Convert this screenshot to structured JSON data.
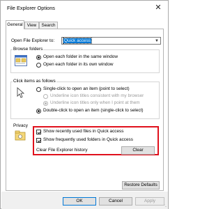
{
  "window": {
    "title": "File Explorer Options",
    "close_glyph": "✕"
  },
  "tabs": [
    {
      "label": "General"
    },
    {
      "label": "View"
    },
    {
      "label": "Search"
    }
  ],
  "general": {
    "open_label": "Open File Explorer to:",
    "open_value": "Quick access",
    "browse": {
      "title": "Browse folders",
      "opt_same": "Open each folder in the same window",
      "opt_own": "Open each folder in its own window",
      "selected": "same"
    },
    "click": {
      "title": "Click items as follows",
      "opt_single": "Single-click to open an item (point to select)",
      "opt_underline_browser": "Underline icon titles consistent with my browser",
      "opt_underline_point": "Underline icon titles only when I point at them",
      "opt_double": "Double-click to open an item (single-click to select)",
      "selected": "double"
    },
    "privacy": {
      "title": "Privacy",
      "recent_files": "Show recently used files in Quick access",
      "recent_files_checked": true,
      "frequent_folders": "Show frequently used folders in Quick access",
      "frequent_folders_checked": true,
      "clear_label": "Clear File Explorer history",
      "clear_button": "Clear"
    },
    "restore_button": "Restore Defaults"
  },
  "buttons": {
    "ok": "OK",
    "cancel": "Cancel",
    "apply": "Apply"
  },
  "colors": {
    "highlight_border": "#e0101c",
    "default_button_border": "#0078d7"
  }
}
